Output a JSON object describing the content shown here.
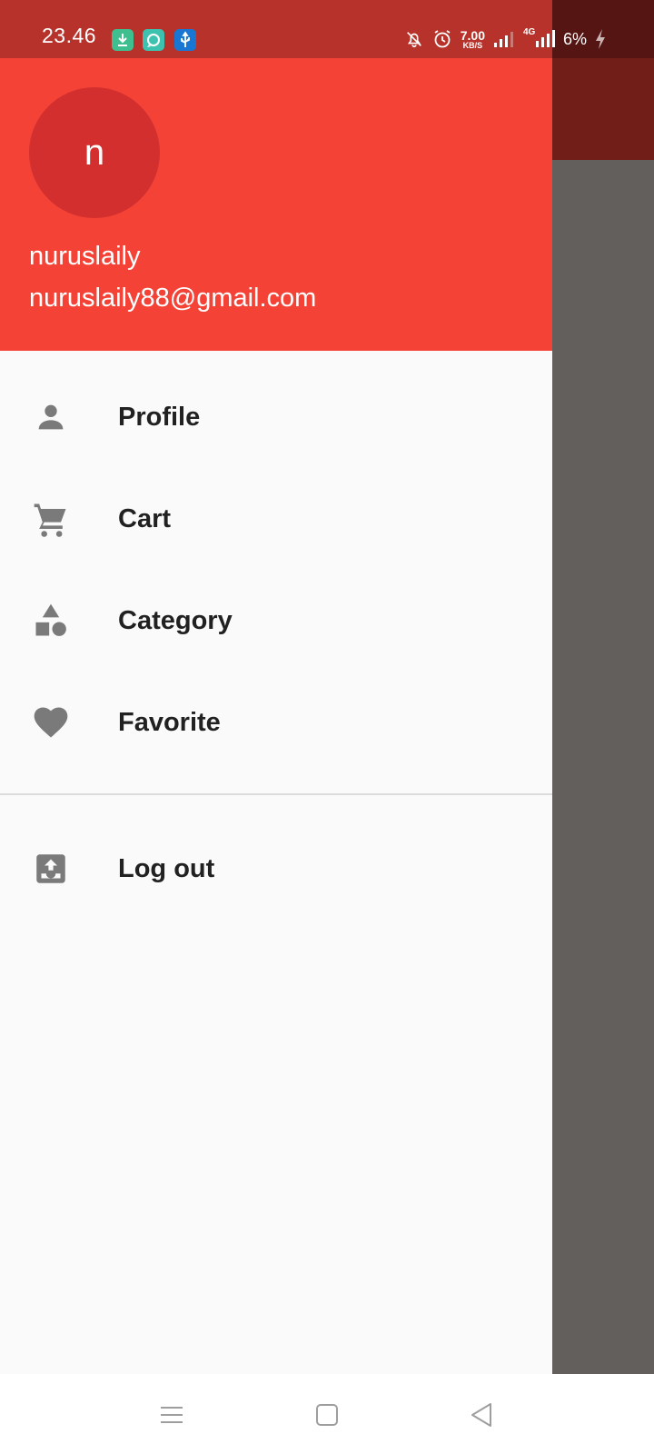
{
  "status_bar": {
    "time": "23.46",
    "net_speed_value": "7.00",
    "net_speed_unit": "KB/S",
    "network": "4G",
    "battery": "6%",
    "icons": [
      "download-icon",
      "chat-app-icon",
      "usb-icon",
      "mute-bell-icon",
      "alarm-icon",
      "signal-icon",
      "signal-4g-icon",
      "charging-icon"
    ]
  },
  "drawer": {
    "header_color": "#f44336",
    "avatar_color": "#d32f2f",
    "avatar_letter": "n",
    "account_name": "nuruslaily",
    "account_email": "nuruslaily88@gmail.com",
    "items": [
      {
        "label": "Profile",
        "icon": "person-icon"
      },
      {
        "label": "Cart",
        "icon": "cart-icon"
      },
      {
        "label": "Category",
        "icon": "category-icon"
      },
      {
        "label": "Favorite",
        "icon": "heart-icon"
      }
    ],
    "logout": {
      "label": "Log out",
      "icon": "logout-icon"
    }
  },
  "nav_bar": {
    "buttons": [
      "menu-icon",
      "home-square-icon",
      "back-triangle-icon"
    ]
  }
}
